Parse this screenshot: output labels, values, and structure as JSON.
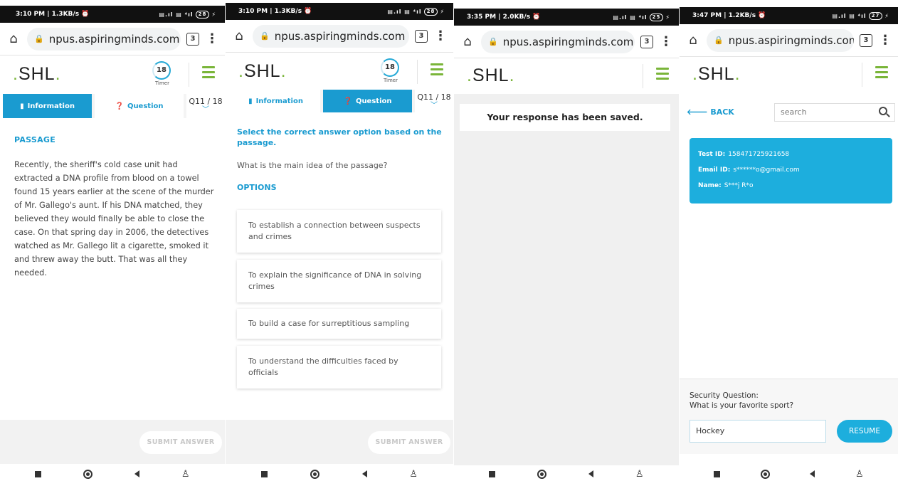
{
  "url": "npus.aspiringminds.com",
  "tab_count": "3",
  "logo": "SHL",
  "timer": {
    "value": "18",
    "label": "Timer"
  },
  "tabs": {
    "information": "Information",
    "question": "Question",
    "qnum": "Q11 / 18"
  },
  "submit_label": "SUBMIT ANSWER",
  "phones": [
    {
      "status_left": "3:10 PM | 1.3KB/s ⏰",
      "battery": "28"
    },
    {
      "status_left": "3:10 PM | 1.3KB/s ⏰",
      "battery": "28"
    },
    {
      "status_left": "3:35 PM | 2.0KB/s ⏰",
      "battery": "25"
    },
    {
      "status_left": "3:47 PM | 1.2KB/s ⏰",
      "battery": "27"
    }
  ],
  "passage": {
    "title": "PASSAGE",
    "text": "Recently, the sheriff's cold case unit had extracted a DNA profile from blood on a towel found 15 years earlier at the scene of the murder of Mr. Gallego's aunt. If his DNA matched, they believed they would finally be able to close the case. On that spring day in 2006, the detectives watched as Mr. Gallego lit a cigarette, smoked it and threw away the butt. That was all they needed."
  },
  "question": {
    "instruction": "Select the correct answer option based on the passage.",
    "text": "What is the main idea of the passage?",
    "options_title": "OPTIONS",
    "options": [
      "To establish a connection between suspects and crimes",
      "To explain the significance of DNA in solving crimes",
      "To build a case for surreptitious sampling",
      "To understand the difficulties faced by officials"
    ]
  },
  "saved_message": "Your response has been saved.",
  "resume": {
    "back": "BACK",
    "search_placeholder": "search",
    "test_id_label": "Test ID:",
    "test_id": "158471725921658",
    "email_label": "Email ID:",
    "email": "s******o@gmail.com",
    "name_label": "Name:",
    "name": "S***j R*o",
    "security_title": "Security Question:",
    "security_question": "What is your favorite sport?",
    "answer": "Hockey",
    "resume_label": "RESUME"
  },
  "colors": {
    "accent": "#1a9bd0",
    "logo_dot": "#7ab539",
    "card": "#1daedd"
  }
}
